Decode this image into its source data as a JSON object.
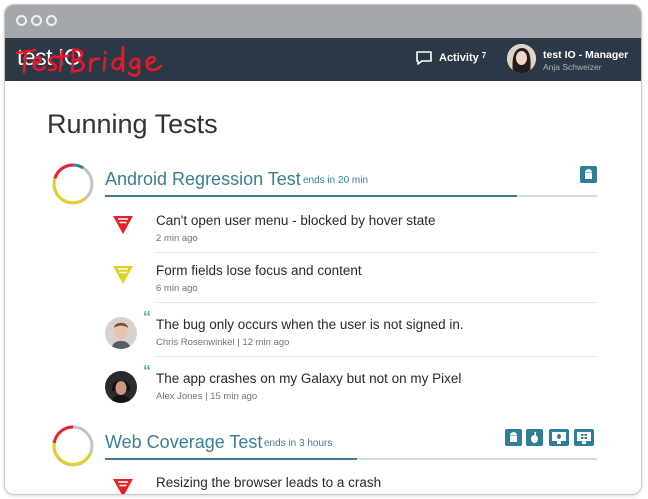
{
  "app": {
    "logo_text": "test IO",
    "logo_scribble": "testBridge",
    "activity_label": "Activity",
    "activity_count": "7",
    "user_name": "test IO - Manager",
    "user_sub": "Anja Schweizer"
  },
  "page": {
    "title": "Running Tests"
  },
  "tests": [
    {
      "title": "Android Regression Test",
      "ends": "ends in 20 min",
      "progress": 0.76,
      "platforms": [
        "android-icon"
      ],
      "items": [
        {
          "kind": "bug",
          "severity": "critical",
          "text": "Can't open user menu - blocked by hover state",
          "meta": "2 min ago"
        },
        {
          "kind": "bug",
          "severity": "high",
          "text": "Form fields lose focus and content",
          "meta": "6 min ago"
        },
        {
          "kind": "comment",
          "text": "The bug only occurs when the user is not signed in.",
          "meta": "Chris Rosenwinkel | 12 min ago"
        },
        {
          "kind": "comment",
          "text": "The app crashes on my Galaxy but not on my Pixel",
          "meta": "Alex Jones | 15 min ago"
        }
      ]
    },
    {
      "title": "Web Coverage Test",
      "ends": "ends in 3 hours",
      "progress": 0.38,
      "platforms": [
        "android-icon",
        "apple-icon",
        "mac-desktop-icon",
        "windows-desktop-icon"
      ],
      "items": [
        {
          "kind": "bug",
          "severity": "critical",
          "text": "Resizing the browser leads to a crash",
          "meta": ""
        }
      ]
    }
  ],
  "colors": {
    "accent": "#3b7c97",
    "critical": "#e32229",
    "high": "#e2d024",
    "appbar": "#2b3845",
    "titlebar": "#a4a7ab",
    "scribble": "#e8182a"
  }
}
